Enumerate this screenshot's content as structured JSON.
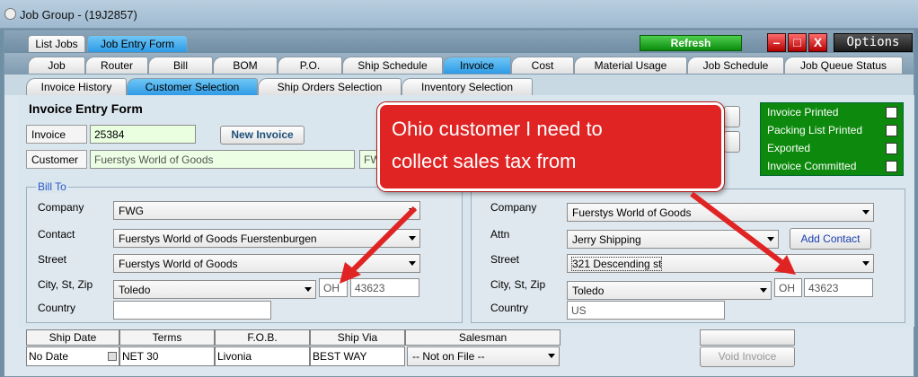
{
  "window": {
    "title": "Job Group - (19J2857)"
  },
  "top_tabs": [
    {
      "label": "List Jobs"
    },
    {
      "label": "Job Entry Form"
    }
  ],
  "toolbar": {
    "refresh_label": "Refresh",
    "options_label": "Options",
    "minimize_glyph": "–",
    "maximize_glyph": "□",
    "close_glyph": "X"
  },
  "main_tabs": [
    {
      "label": "Job"
    },
    {
      "label": "Router"
    },
    {
      "label": "Bill"
    },
    {
      "label": "BOM"
    },
    {
      "label": "P.O."
    },
    {
      "label": "Ship Schedule"
    },
    {
      "label": "Invoice"
    },
    {
      "label": "Cost"
    },
    {
      "label": "Material Usage"
    },
    {
      "label": "Job Schedule"
    },
    {
      "label": "Job Queue Status"
    }
  ],
  "sub_tabs": [
    {
      "label": "Invoice History"
    },
    {
      "label": "Customer Selection"
    },
    {
      "label": "Ship Orders Selection"
    },
    {
      "label": "Inventory Selection"
    }
  ],
  "form": {
    "title": "Invoice Entry Form",
    "invoice_label": "Invoice",
    "invoice_value": "25384",
    "new_invoice_label": "New Invoice",
    "customer_label": "Customer",
    "customer_value": "Fuerstys World of Goods",
    "customer_code": "FW"
  },
  "status": {
    "invoice_printed": "Invoice Printed",
    "packing_list_printed": "Packing List Printed",
    "exported": "Exported",
    "invoice_committed": "Invoice Committed"
  },
  "callout": {
    "line1": "Ohio customer I need to",
    "line2": "collect sales tax from"
  },
  "bill_to": {
    "legend": "Bill To",
    "company_label": "Company",
    "company_value": "FWG",
    "contact_label": "Contact",
    "contact_value": "Fuerstys World of Goods Fuerstenburgen",
    "street_label": "Street",
    "street_value": "Fuerstys World of Goods",
    "city_label": "City, St, Zip",
    "city_value": "Toledo",
    "state_value": "OH",
    "zip_value": "43623",
    "country_label": "Country",
    "country_value": ""
  },
  "ship_to": {
    "company_label": "Company",
    "company_value": "Fuerstys World of Goods",
    "attn_label": "Attn",
    "attn_value": "Jerry Shipping",
    "add_contact_label": "Add Contact",
    "street_label": "Street",
    "street_value": "321 Descending st",
    "city_label": "City, St, Zip",
    "city_value": "Toledo",
    "state_value": "OH",
    "zip_value": "43623",
    "country_label": "Country",
    "country_value": "US"
  },
  "grid": {
    "headers": [
      "Ship Date",
      "Terms",
      "F.O.B.",
      "Ship Via",
      "Salesman"
    ],
    "values": [
      "No Date",
      "NET 30",
      "Livonia",
      "BEST WAY",
      "-- Not on File --"
    ]
  },
  "void_invoice_label": "Void Invoice"
}
